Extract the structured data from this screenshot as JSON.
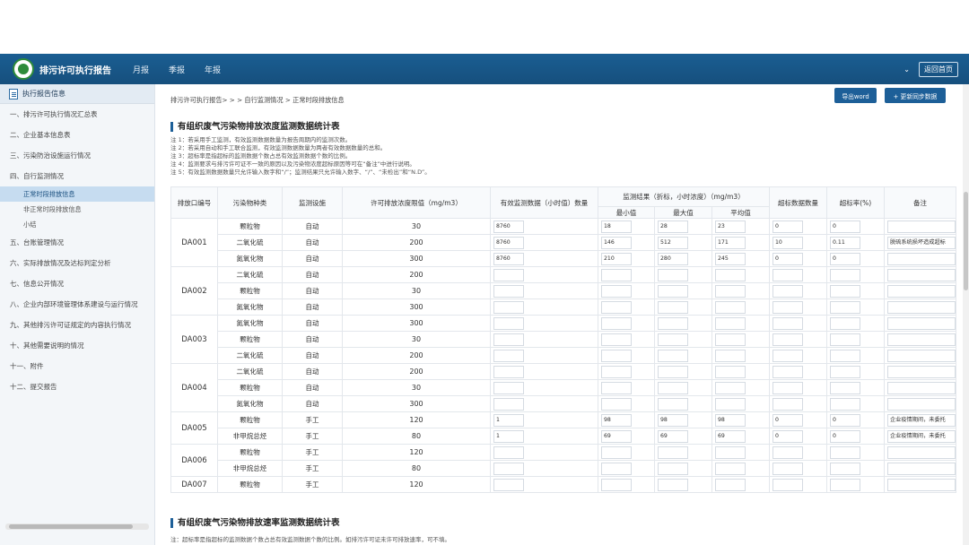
{
  "header": {
    "brand": "排污许可执行报告",
    "nav": [
      "月报",
      "季报",
      "年报"
    ],
    "back_home": "返回首页"
  },
  "sidebar": {
    "title": "执行报告信息",
    "items": [
      {
        "label": "一、排污许可执行情况汇总表"
      },
      {
        "label": "二、企业基本信息表"
      },
      {
        "label": "三、污染防治设施运行情况"
      },
      {
        "label": "四、自行监测情况",
        "children": [
          "正常时段排放信息",
          "非正常时段排放信息",
          "小结"
        ]
      },
      {
        "label": "五、台账管理情况"
      },
      {
        "label": "六、实际排放情况及达标判定分析"
      },
      {
        "label": "七、信息公开情况"
      },
      {
        "label": "八、企业内部环境管理体系建设与运行情况"
      },
      {
        "label": "九、其他排污许可证规定的内容执行情况"
      },
      {
        "label": "十、其他需要说明的情况"
      },
      {
        "label": "十一、附件"
      },
      {
        "label": "十二、提交报告"
      }
    ],
    "active_child": "正常时段排放信息"
  },
  "main": {
    "breadcrumb": "排污许可执行报告> > > 自行监测情况 > 正常时段排放信息",
    "export_button": "导出word",
    "sync_button": "+ 更新同步数据",
    "section1_title": "有组织废气污染物排放浓度监测数据统计表",
    "notes": [
      "注 1：若采用手工监测，有效监测数据数量为报告周期内的监测次数。",
      "注 2：若采用自动和手工联合监测，有效监测数据数量为两者有效数据数量的总和。",
      "注 3：超标率是指超标的监测数据个数占总有效监测数据个数的比例。",
      "注 4：监测要求与排污许可证不一致的原因以及污染物浓度超标原因等可在“备注”中进行说明。",
      "注 5：有效监测数据数量只允许输入数字和“/”；监测结果只允许输入数字、“/”、“未检出”和“N.D”。"
    ],
    "table": {
      "headers": {
        "outlet": "排放口编号",
        "pollutant": "污染物种类",
        "facility": "监测设施",
        "limit": "许可排放浓度限值（mg/m3）",
        "valid_count": "有效监测数据（小时值）数量",
        "result_group": "监测结果（折标，小时浓度）（mg/m3）",
        "min": "最小值",
        "max": "最大值",
        "avg": "平均值",
        "exceed_count": "超标数据数量",
        "exceed_rate": "超标率(%)",
        "remark": "备注"
      },
      "groups": [
        {
          "outlet": "DA001",
          "rows": [
            {
              "pollutant": "颗粒物",
              "facility": "自动",
              "limit": "30",
              "valid": "8760",
              "min": "18",
              "max": "28",
              "avg": "23",
              "exceed": "0",
              "rate": "0",
              "remark": ""
            },
            {
              "pollutant": "二氧化硫",
              "facility": "自动",
              "limit": "200",
              "valid": "8760",
              "min": "146",
              "max": "512",
              "avg": "171",
              "exceed": "10",
              "rate": "0.11",
              "remark": "脱硫系统损坏造成超标"
            },
            {
              "pollutant": "氮氧化物",
              "facility": "自动",
              "limit": "300",
              "valid": "8760",
              "min": "210",
              "max": "280",
              "avg": "245",
              "exceed": "0",
              "rate": "0",
              "remark": ""
            }
          ]
        },
        {
          "outlet": "DA002",
          "rows": [
            {
              "pollutant": "二氧化硫",
              "facility": "自动",
              "limit": "200",
              "valid": "",
              "min": "",
              "max": "",
              "avg": "",
              "exceed": "",
              "rate": "",
              "remark": ""
            },
            {
              "pollutant": "颗粒物",
              "facility": "自动",
              "limit": "30",
              "valid": "",
              "min": "",
              "max": "",
              "avg": "",
              "exceed": "",
              "rate": "",
              "remark": ""
            },
            {
              "pollutant": "氮氧化物",
              "facility": "自动",
              "limit": "300",
              "valid": "",
              "min": "",
              "max": "",
              "avg": "",
              "exceed": "",
              "rate": "",
              "remark": ""
            }
          ]
        },
        {
          "outlet": "DA003",
          "rows": [
            {
              "pollutant": "氮氧化物",
              "facility": "自动",
              "limit": "300",
              "valid": "",
              "min": "",
              "max": "",
              "avg": "",
              "exceed": "",
              "rate": "",
              "remark": ""
            },
            {
              "pollutant": "颗粒物",
              "facility": "自动",
              "limit": "30",
              "valid": "",
              "min": "",
              "max": "",
              "avg": "",
              "exceed": "",
              "rate": "",
              "remark": ""
            },
            {
              "pollutant": "二氧化硫",
              "facility": "自动",
              "limit": "200",
              "valid": "",
              "min": "",
              "max": "",
              "avg": "",
              "exceed": "",
              "rate": "",
              "remark": ""
            }
          ]
        },
        {
          "outlet": "DA004",
          "rows": [
            {
              "pollutant": "二氧化硫",
              "facility": "自动",
              "limit": "200",
              "valid": "",
              "min": "",
              "max": "",
              "avg": "",
              "exceed": "",
              "rate": "",
              "remark": ""
            },
            {
              "pollutant": "颗粒物",
              "facility": "自动",
              "limit": "30",
              "valid": "",
              "min": "",
              "max": "",
              "avg": "",
              "exceed": "",
              "rate": "",
              "remark": ""
            },
            {
              "pollutant": "氮氧化物",
              "facility": "自动",
              "limit": "300",
              "valid": "",
              "min": "",
              "max": "",
              "avg": "",
              "exceed": "",
              "rate": "",
              "remark": ""
            }
          ]
        },
        {
          "outlet": "DA005",
          "rows": [
            {
              "pollutant": "颗粒物",
              "facility": "手工",
              "limit": "120",
              "valid": "1",
              "min": "98",
              "max": "98",
              "avg": "98",
              "exceed": "0",
              "rate": "0",
              "remark": "企业疫情期间，未委托"
            },
            {
              "pollutant": "非甲烷总烃",
              "facility": "手工",
              "limit": "80",
              "valid": "1",
              "min": "69",
              "max": "69",
              "avg": "69",
              "exceed": "0",
              "rate": "0",
              "remark": "企业疫情期间，未委托"
            }
          ]
        },
        {
          "outlet": "DA006",
          "rows": [
            {
              "pollutant": "颗粒物",
              "facility": "手工",
              "limit": "120",
              "valid": "",
              "min": "",
              "max": "",
              "avg": "",
              "exceed": "",
              "rate": "",
              "remark": ""
            },
            {
              "pollutant": "非甲烷总烃",
              "facility": "手工",
              "limit": "80",
              "valid": "",
              "min": "",
              "max": "",
              "avg": "",
              "exceed": "",
              "rate": "",
              "remark": ""
            }
          ]
        },
        {
          "outlet": "DA007",
          "rows": [
            {
              "pollutant": "颗粒物",
              "facility": "手工",
              "limit": "120",
              "valid": "",
              "min": "",
              "max": "",
              "avg": "",
              "exceed": "",
              "rate": "",
              "remark": ""
            }
          ]
        }
      ]
    },
    "section2_title": "有组织废气污染物排放速率监测数据统计表",
    "section2_note": "注：超标率是指超标的监测数据个数占总有效监测数据个数的比例。如排污许可证未许可排放速率，可不填。"
  }
}
